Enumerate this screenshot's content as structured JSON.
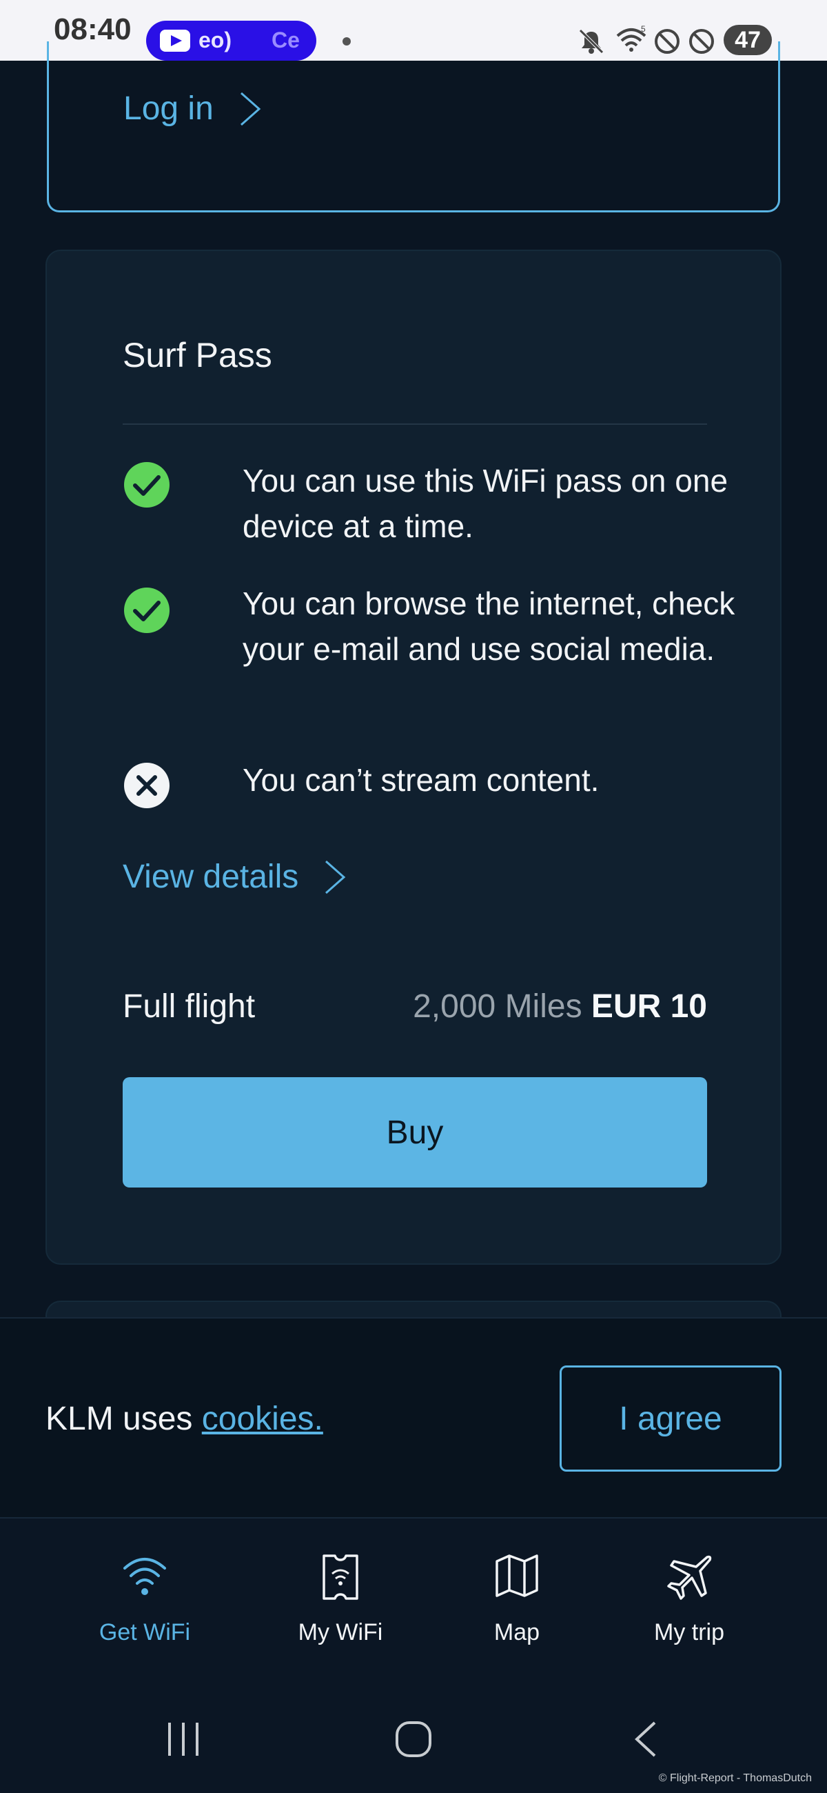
{
  "status_bar": {
    "time": "08:40",
    "notification_text": "eo)",
    "notification_text_2": "Ce",
    "battery": "47",
    "icons": [
      "youtube-icon",
      "mute-icon",
      "wifi-icon",
      "block-icon",
      "block-icon",
      "battery-icon"
    ]
  },
  "login": {
    "label": "Log in"
  },
  "surf_pass": {
    "title": "Surf Pass",
    "features": [
      {
        "icon": "check-icon",
        "text": "You can use this WiFi pass on one device at a time."
      },
      {
        "icon": "check-icon",
        "text": "You can browse the internet, check your e-mail and use social media."
      },
      {
        "icon": "cross-icon",
        "text": "You can’t stream content."
      }
    ],
    "view_details": "View details",
    "price_label": "Full flight",
    "price_miles": "2,000 Miles",
    "price_eur": "EUR 10",
    "buy_label": "Buy"
  },
  "cookie": {
    "text": "KLM uses",
    "link": "cookies.",
    "agree_label": "I agree"
  },
  "bottom_nav": [
    {
      "label": "Get WiFi",
      "icon": "wifi-icon",
      "active": true
    },
    {
      "label": "My WiFi",
      "icon": "ticket-icon",
      "active": false
    },
    {
      "label": "Map",
      "icon": "map-icon",
      "active": false
    },
    {
      "label": "My trip",
      "icon": "plane-icon",
      "active": false
    }
  ],
  "watermark": "© Flight-Report - ThomasDutch",
  "colors": {
    "accent": "#5ab4e4",
    "check": "#5fd45a",
    "background": "#0a1522",
    "card": "#10202f"
  }
}
